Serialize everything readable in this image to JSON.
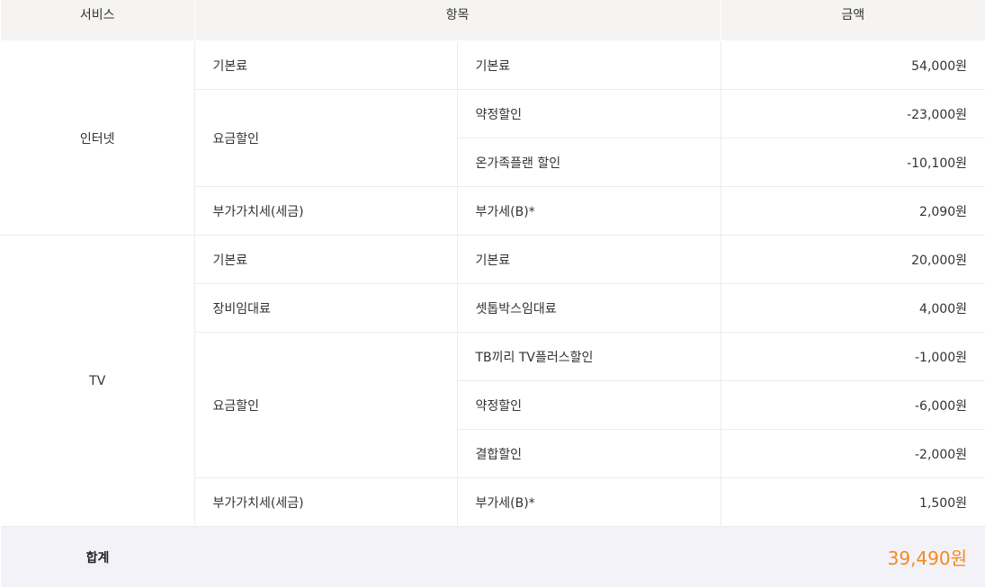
{
  "header": {
    "service": "서비스",
    "item": "항목",
    "amount": "금액"
  },
  "internet": {
    "name": "인터넷",
    "rows": [
      {
        "category": "기본료",
        "item": "기본료",
        "amount": "54,000원"
      },
      {
        "category": "요금할인",
        "item": "약정할인",
        "amount": "-23,000원"
      },
      {
        "item": "온가족플랜 할인",
        "amount": "-10,100원"
      },
      {
        "category": "부가가치세(세금)",
        "item": "부가세(B)*",
        "amount": "2,090원"
      }
    ]
  },
  "tv": {
    "name": "TV",
    "rows": [
      {
        "category": "기본료",
        "item": "기본료",
        "amount": "20,000원"
      },
      {
        "category": "장비임대료",
        "item": "셋톱박스임대료",
        "amount": "4,000원"
      },
      {
        "category": "요금할인",
        "item": "TB끼리 TV플러스할인",
        "amount": "-1,000원"
      },
      {
        "item": "약정할인",
        "amount": "-6,000원"
      },
      {
        "item": "결합할인",
        "amount": "-2,000원"
      },
      {
        "category": "부가가치세(세금)",
        "item": "부가세(B)*",
        "amount": "1,500원"
      }
    ]
  },
  "total": {
    "label": "합계",
    "amount": "39,490원"
  },
  "colors": {
    "header_bg": "#f5f4f2",
    "total_bg": "#f3f2f9",
    "total_amount": "#f28b20",
    "border": "#ececec"
  }
}
